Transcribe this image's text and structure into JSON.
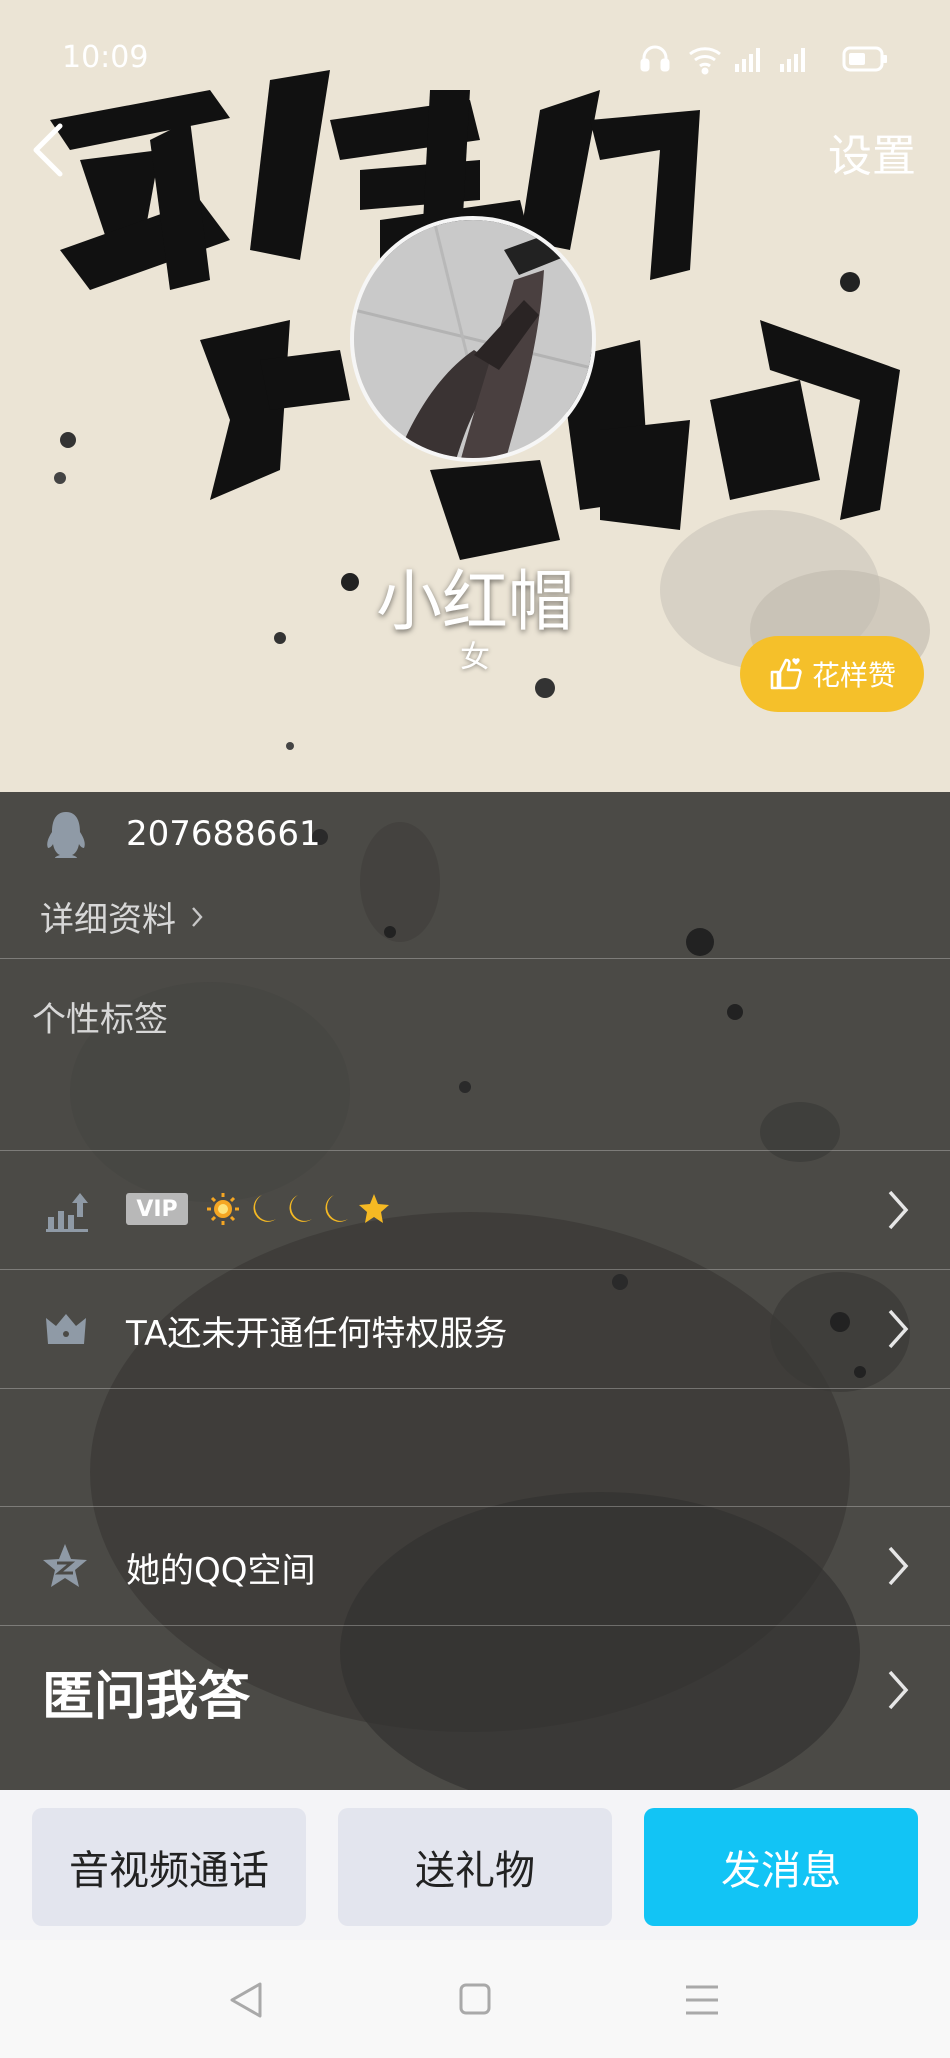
{
  "status_bar": {
    "time": "10:09"
  },
  "header": {
    "settings_label": "设置",
    "calligraphy_text": "竞争们 拼搏吧",
    "username": "小红帽",
    "gender": "女",
    "like_label": "花样赞"
  },
  "profile": {
    "qq_number": "207688661",
    "details_link": "详细资料",
    "tags_label": "个性标签",
    "vip_badge": "VIP",
    "level_icons": [
      "sun-icon",
      "moon-icon",
      "moon-icon",
      "moon-icon",
      "star-icon"
    ],
    "privilege_text": "TA还未开通任何特权服务",
    "qzone_text": "她的QQ空间",
    "anon_qa_text": "匿问我答"
  },
  "actions": {
    "call_label": "音视频通话",
    "gift_label": "送礼物",
    "message_label": "发消息"
  },
  "colors": {
    "accent_blue": "#12c4f5",
    "like_yellow": "#f5c02a",
    "content_bg": "#4b4a46"
  }
}
